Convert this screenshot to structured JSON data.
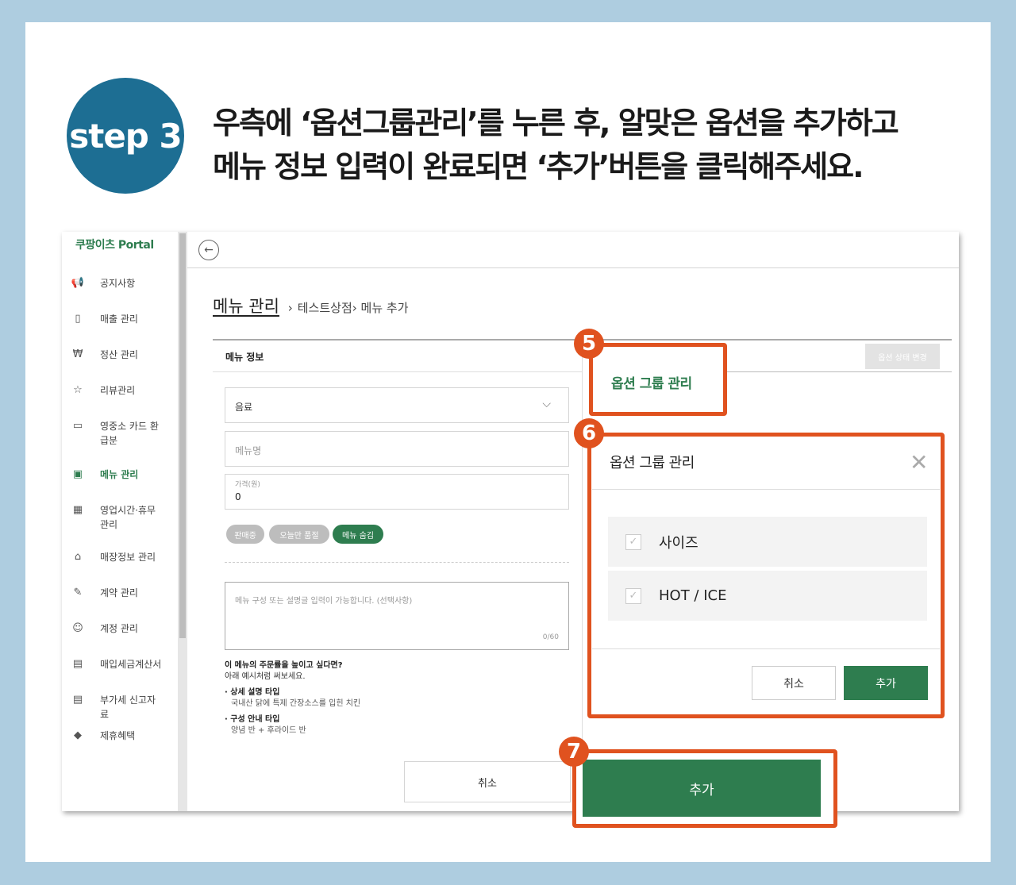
{
  "step": {
    "label": "step 3"
  },
  "headline": {
    "line1": "우측에 ‘옵션그룹관리’를 누른 후, 알맞은 옵션을 추가하고",
    "line2": "메뉴 정보 입력이 완료되면 ‘추가’버튼을 클릭해주세요."
  },
  "sidebar": {
    "brand": "쿠팡이츠 Portal",
    "items": [
      {
        "label": "공지사항",
        "icon": "megaphone-icon",
        "glyph": "📢"
      },
      {
        "label": "매출 관리",
        "icon": "bar-chart-icon",
        "glyph": "▯"
      },
      {
        "label": "정산 관리",
        "icon": "settlement-icon",
        "glyph": "₩"
      },
      {
        "label": "리뷰관리",
        "icon": "star-review-icon",
        "glyph": "☆"
      },
      {
        "label": "영중소 카드 환급분",
        "icon": "card-icon",
        "glyph": "▭"
      },
      {
        "label": "메뉴 관리",
        "icon": "menu-book-icon",
        "glyph": "▣",
        "active": true
      },
      {
        "label": "영업시간·휴무 관리",
        "icon": "calendar-icon",
        "glyph": "▦"
      },
      {
        "label": "매장정보 관리",
        "icon": "store-icon",
        "glyph": "⌂"
      },
      {
        "label": "계약 관리",
        "icon": "contract-icon",
        "glyph": "✎"
      },
      {
        "label": "계정 관리",
        "icon": "user-icon",
        "glyph": "☺"
      },
      {
        "label": "매입세금계산서",
        "icon": "calculator-icon",
        "glyph": "▤"
      },
      {
        "label": "부가세 신고자료",
        "icon": "document-icon",
        "glyph": "▤"
      },
      {
        "label": "제휴혜택",
        "icon": "diamond-icon",
        "glyph": "◆"
      }
    ]
  },
  "breadcrumb": {
    "root": "메뉴 관리",
    "sep": "›",
    "store": "테스트상점",
    "page": "메뉴 추가"
  },
  "menu_info": {
    "section_title": "메뉴 정보",
    "category_value": "음료",
    "name_placeholder": "메뉴명",
    "price_label": "가격(원)",
    "price_value": "0",
    "chips": [
      "판매중",
      "오늘만 품절",
      "메뉴 숨김"
    ],
    "desc_placeholder": "메뉴 구성 또는 설명글 입력이 가능합니다. (선택사항)",
    "desc_count": "0/60",
    "tips": {
      "title": "이 메뉴의 주문률을 높이고 싶다면?",
      "sub": "아래 예시처럼 써보세요.",
      "t1_title": "· 상세 설명 타입",
      "t1_text": "국내산 닭에 특제 간장소스를 입힌 치킨",
      "t2_title": "· 구성 안내 타입",
      "t2_text": "양념 반 + 후라이드 반"
    },
    "cancel_label": "취소",
    "add_label": "추가"
  },
  "option_panel": {
    "status_button": "옵션 상태 변경",
    "tab_label": "옵션 그룹 관리"
  },
  "modal": {
    "title": "옵션 그룹 관리",
    "options": [
      "사이즈",
      "HOT / ICE"
    ],
    "cancel_label": "취소",
    "add_label": "추가"
  },
  "badges": [
    "5",
    "6",
    "7"
  ],
  "colors": {
    "accent_green": "#2e7d4f",
    "highlight_orange": "#e0521f",
    "step_blue": "#1d6e93",
    "bg_blue": "#aecde0"
  }
}
